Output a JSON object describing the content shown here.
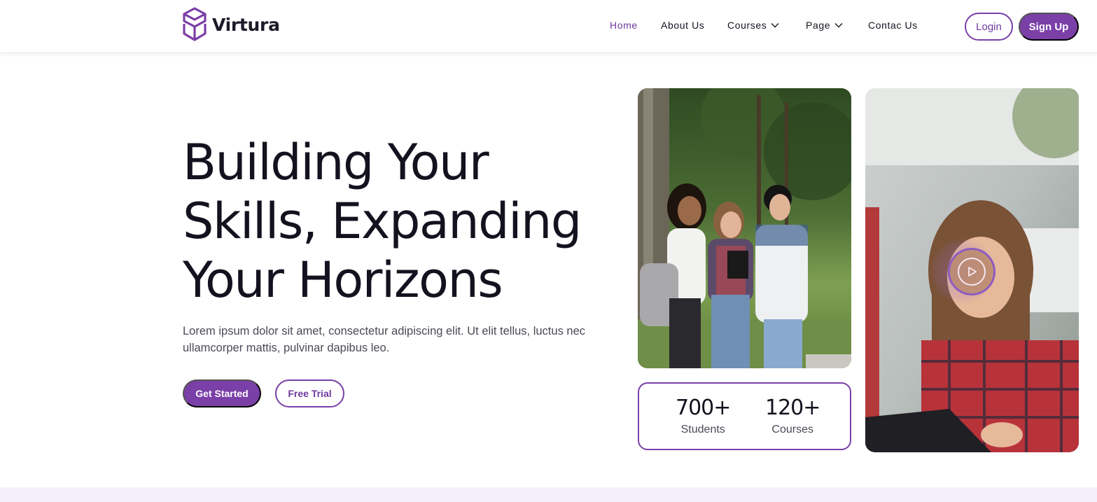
{
  "brand": {
    "name": "Virtura",
    "accent": "#7b3fa8"
  },
  "nav": {
    "items": [
      {
        "label": "Home",
        "active": true
      },
      {
        "label": "About Us"
      },
      {
        "label": "Courses",
        "dropdown": true
      },
      {
        "label": "Page",
        "dropdown": true
      },
      {
        "label": "Contac Us"
      }
    ],
    "login_label": "Login",
    "signup_label": "Sign Up"
  },
  "hero": {
    "title_lines": [
      "Building Your",
      "Skills, Expanding",
      "Your Horizons"
    ],
    "description": "Lorem ipsum dolor sit amet, consectetur adipiscing elit. Ut elit tellus, luctus nec ullamcorper mattis, pulvinar dapibus leo.",
    "primary_cta": "Get Started",
    "secondary_cta": "Free Trial"
  },
  "stats": [
    {
      "value": "700+",
      "label": "Students"
    },
    {
      "value": "120+",
      "label": "Courses"
    }
  ],
  "media": {
    "photo1_icon": "students-photo",
    "photo2_icon": "student-tablet-photo",
    "play_icon": "play-icon"
  }
}
